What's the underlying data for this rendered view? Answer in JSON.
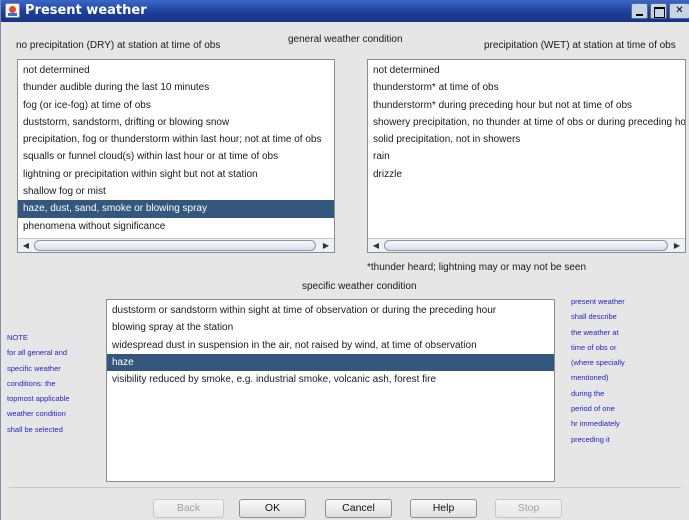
{
  "window": {
    "title": "Present weather"
  },
  "labels": {
    "dry": "no precipitation (DRY) at station at time of obs",
    "general": "general weather condition",
    "wet": "precipitation (WET) at station at time of obs",
    "footnote": "*thunder heard; lightning may or may not be seen",
    "specific": "specific weather condition"
  },
  "dry_list": [
    "not determined",
    "thunder audible during the last 10 minutes",
    "fog (or ice-fog) at time of obs",
    "duststorm, sandstorm, drifting or blowing snow",
    "precipitation, fog or thunderstorm within last hour; not at time of obs",
    "squalls or funnel cloud(s) within last hour or at time of obs",
    "lightning or precipitation within sight but not at station",
    "shallow fog or mist",
    "haze, dust, sand, smoke or blowing spray",
    "phenomena without significance"
  ],
  "dry_selected_index": 8,
  "wet_list": [
    "not determined",
    "thunderstorm* at time of obs",
    "thunderstorm* during preceding hour but not at time of obs",
    "showery precipitation, no thunder at time of obs or during preceding hour",
    "solid precipitation, not in showers",
    "rain",
    "drizzle"
  ],
  "specific_list": [
    "duststorm or sandstorm within sight at time of observation or during the preceding hour",
    "blowing spray at the station",
    "widespread dust in suspension in the air, not raised by wind, at time of observation",
    "haze",
    "visibility reduced by smoke, e.g. industrial smoke, volcanic ash, forest fire"
  ],
  "specific_selected_index": 3,
  "note": [
    "NOTE",
    "for all general and",
    "specific weather",
    "conditions: the",
    "topmost applicable",
    "weather condition",
    "shall be selected"
  ],
  "side_note": [
    "present weather",
    "shall describe",
    "the weather at",
    "time of obs or",
    "(where specially",
    "mentioned)",
    "during  the",
    "period of one",
    "hr immediately",
    "preceding it"
  ],
  "buttons": {
    "back": "Back",
    "ok": "OK",
    "cancel": "Cancel",
    "help": "Help",
    "stop": "Stop"
  },
  "colors": {
    "selection": "#34577e",
    "note_text": "#2323c8",
    "titlebar": "#1c3f99"
  }
}
